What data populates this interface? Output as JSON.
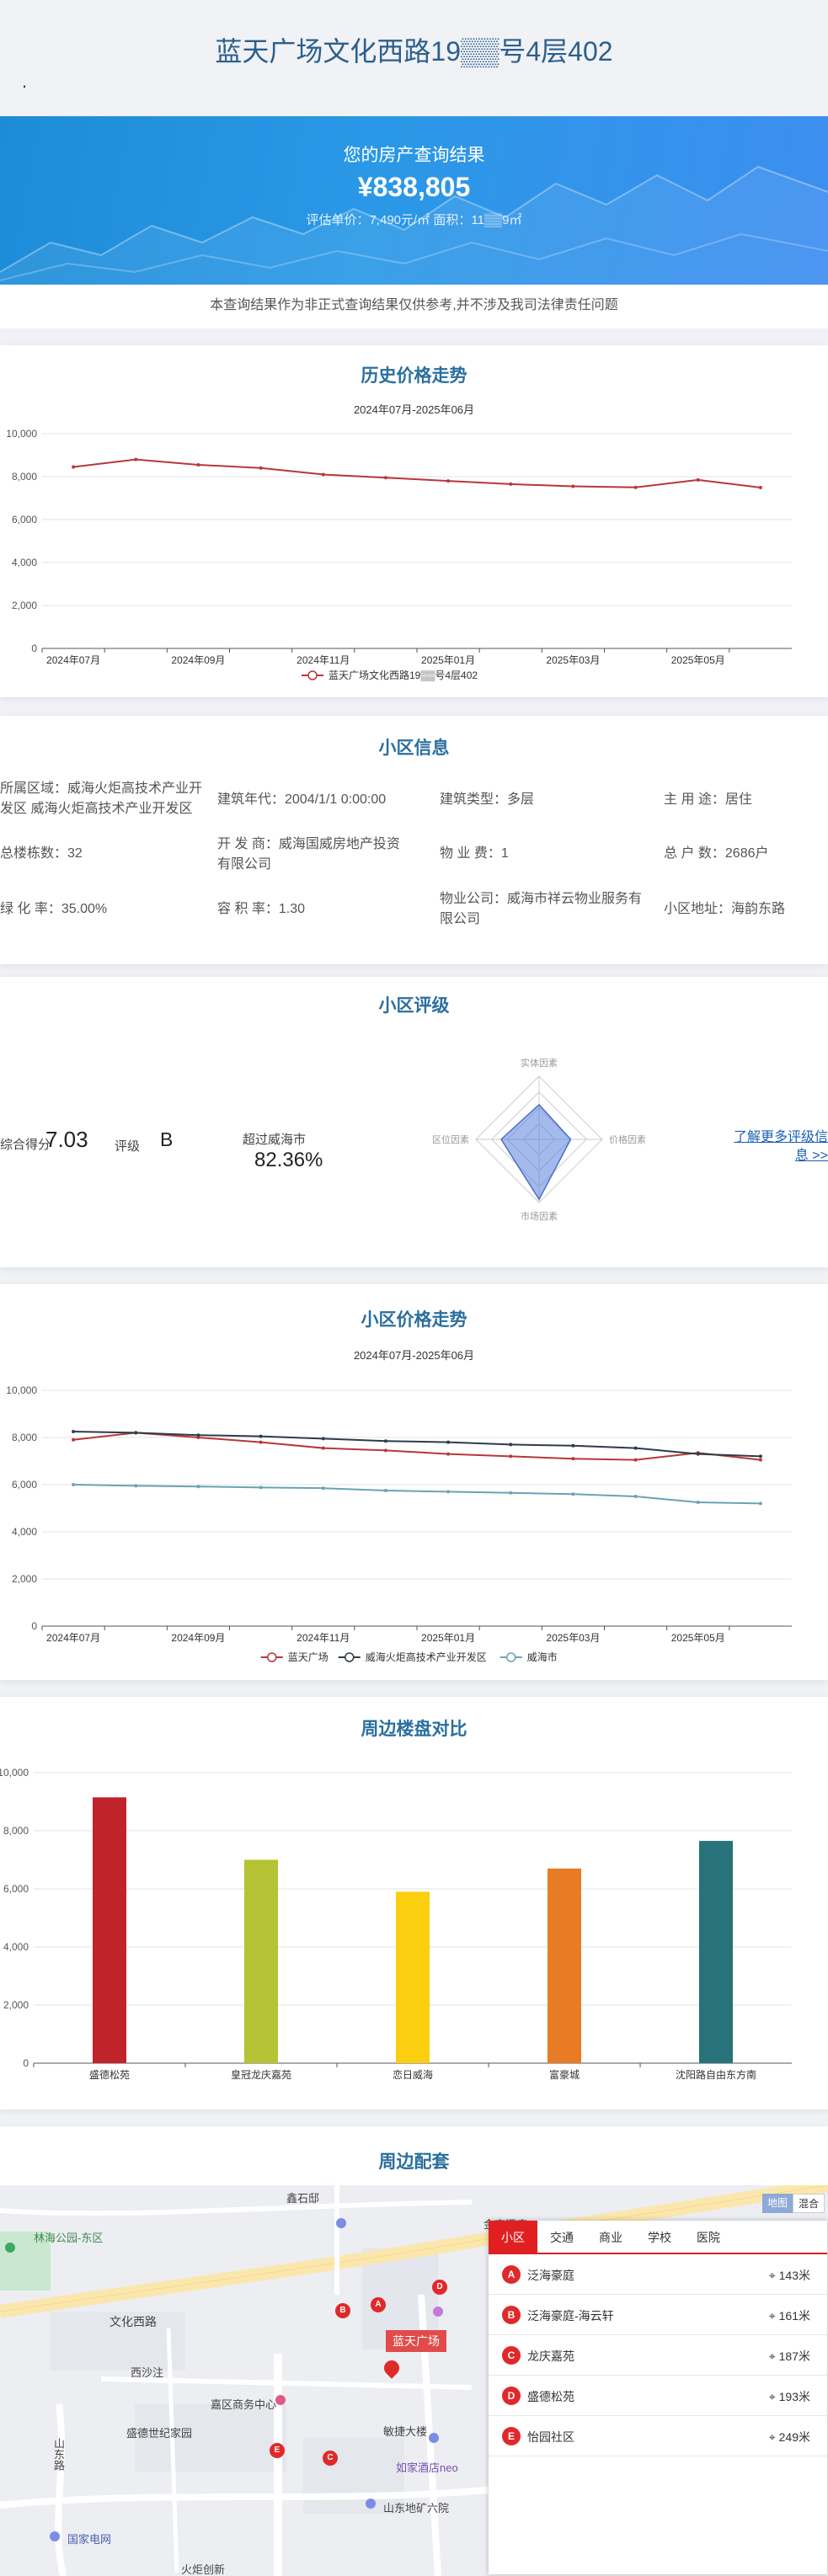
{
  "header": {
    "title": "蓝天广场文化西路19▒▒号4层402",
    "dot": "."
  },
  "hero": {
    "heading": "您的房产查询结果",
    "price": "¥838,805",
    "detail": "评估单价：7,490元/㎡ 面积：11▒▒9㎡"
  },
  "disclaimer": "本查询结果作为非正式查询结果仅供参考,并不涉及我司法律责任问题",
  "history": {
    "title": "历史价格走势",
    "subtitle": "2024年07月-2025年06月"
  },
  "community": {
    "title": "小区信息",
    "items": [
      {
        "label": "所属区域：威海火炬高技术产业开发区 威海火炬高技术产业开发区"
      },
      {
        "label": "建筑年代：2004/1/1 0:00:00"
      },
      {
        "label": "建筑类型：多层"
      },
      {
        "label": "主 用 途：居住"
      },
      {
        "label": "总楼栋数：32"
      },
      {
        "label": "开 发 商：威海国威房地产投资有限公司"
      },
      {
        "label": "物 业 费：1"
      },
      {
        "label": "总 户 数：2686户"
      },
      {
        "label": "绿 化 率：35.00%"
      },
      {
        "label": "容 积 率：1.30"
      },
      {
        "label": "物业公司：威海市祥云物业服务有限公司"
      },
      {
        "label": "小区地址：海韵东路"
      }
    ]
  },
  "rating": {
    "title": "小区评级",
    "score_label": "综合得分",
    "score": "7.03",
    "grade_label": "评级",
    "grade": "B",
    "exceed_label": "超过威海市",
    "exceed": "82.36%",
    "link": "了解更多评级信息 >>",
    "radar": {
      "indicators": [
        "实体因素",
        "价格因素",
        "市场因素",
        "区位因素"
      ],
      "values": [
        0.55,
        0.5,
        0.95,
        0.6
      ]
    }
  },
  "community_trend": {
    "title": "小区价格走势",
    "subtitle": "2024年07月-2025年06月"
  },
  "compare": {
    "title": "周边楼盘对比"
  },
  "nearby": {
    "title": "周边配套",
    "map_buttons": [
      "地图",
      "混合"
    ],
    "tabs": [
      "小区",
      "交通",
      "商业",
      "学校",
      "医院"
    ],
    "places": [
      {
        "pin": "A",
        "name": "泛海豪庭",
        "dist": "143米"
      },
      {
        "pin": "B",
        "name": "泛海豪庭-海云轩",
        "dist": "161米"
      },
      {
        "pin": "C",
        "name": "龙庆嘉苑",
        "dist": "187米"
      },
      {
        "pin": "D",
        "name": "盛德松苑",
        "dist": "193米"
      },
      {
        "pin": "E",
        "name": "怡园社区",
        "dist": "249米"
      }
    ],
    "map_labels": {
      "road1": "文化西路",
      "road2": "西沙注",
      "road3": "盛德世纪家园",
      "center": "蓝天广场",
      "poi1": "山东路",
      "poi2": "鑫石邸",
      "poi3": "林海公园-东区",
      "poi4": "金李酒店",
      "poi5": "敏捷大楼",
      "poi6": "如家酒店neo",
      "poi7": "国家电网",
      "poi8": "山东地矿六院",
      "poi9": "嘉区商务中心",
      "poi10": "火炬创新"
    }
  },
  "chart_data": [
    {
      "type": "line",
      "title": "历史价格走势",
      "categories": [
        "2024年07月",
        "2024年08月",
        "2024年09月",
        "2024年10月",
        "2024年11月",
        "2024年12月",
        "2025年01月",
        "2025年02月",
        "2025年03月",
        "2025年04月",
        "2025年05月",
        "2025年06月"
      ],
      "tick_labels": [
        "2024年07月",
        "2024年09月",
        "2024年11月",
        "2025年01月",
        "2025年03月",
        "2025年05月"
      ],
      "series": [
        {
          "name": "蓝天广场文化西路19▒▒号4层402",
          "color": "#b8373a",
          "values": [
            8450,
            8800,
            8550,
            8400,
            8100,
            7950,
            7800,
            7650,
            7550,
            7500,
            7850,
            7490
          ]
        }
      ],
      "ylim": [
        0,
        10000
      ],
      "yticks": [
        "0",
        "2,000",
        "4,000",
        "6,000",
        "8,000",
        "10,000"
      ]
    },
    {
      "type": "line",
      "title": "小区价格走势",
      "categories": [
        "2024年07月",
        "2024年08月",
        "2024年09月",
        "2024年10月",
        "2024年11月",
        "2024年12月",
        "2025年01月",
        "2025年02月",
        "2025年03月",
        "2025年04月",
        "2025年05月",
        "2025年06月"
      ],
      "tick_labels": [
        "2024年07月",
        "2024年09月",
        "2024年11月",
        "2025年01月",
        "2025年03月",
        "2025年05月"
      ],
      "series": [
        {
          "name": "蓝天广场",
          "color": "#b8373a",
          "values": [
            7900,
            8200,
            8000,
            7800,
            7550,
            7450,
            7300,
            7200,
            7100,
            7050,
            7350,
            7050
          ]
        },
        {
          "name": "威海火炬高技术产业开发区",
          "color": "#2f3b4a",
          "values": [
            8250,
            8200,
            8100,
            8050,
            7950,
            7850,
            7800,
            7700,
            7650,
            7550,
            7300,
            7200
          ]
        },
        {
          "name": "威海市",
          "color": "#6aa3b4",
          "values": [
            6000,
            5950,
            5920,
            5880,
            5850,
            5750,
            5700,
            5650,
            5600,
            5500,
            5250,
            5200
          ]
        }
      ],
      "ylim": [
        0,
        10000
      ],
      "yticks": [
        "0",
        "2,000",
        "4,000",
        "6,000",
        "8,000",
        "10,000"
      ]
    },
    {
      "type": "bar",
      "title": "周边楼盘对比",
      "categories": [
        "盛德松苑",
        "皇冠龙庆嘉苑",
        "恋日威海",
        "富豪城",
        "沈阳路自由东方南"
      ],
      "values": [
        9150,
        7000,
        5900,
        6700,
        7650
      ],
      "colors": [
        "#c1232b",
        "#b5c334",
        "#fcce10",
        "#e87c25",
        "#27727b"
      ],
      "ylim": [
        0,
        10000
      ],
      "yticks": [
        "0",
        "2,000",
        "4,000",
        "6,000",
        "8,000",
        "10,000"
      ]
    }
  ]
}
